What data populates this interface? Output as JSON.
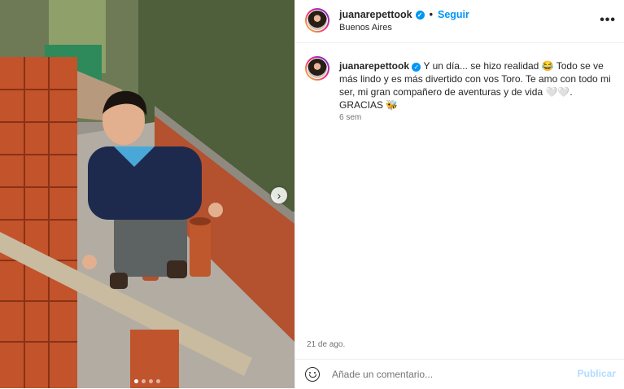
{
  "post": {
    "username": "juanarepettook",
    "follow_label": "Seguir",
    "location": "Buenos Aires",
    "more_label": "•••",
    "verified_mark": "✓",
    "separator": "•"
  },
  "caption": {
    "username": "juanarepettook",
    "text": "Y un día... se hizo realidad 😂 Todo se ve más lindo y es más divertido con vos Toro. Te amo con todo mi ser, mi gran compañero de aventuras y de vida 🤍🤍. GRACIAS 🐝",
    "time_ago": "6 sem"
  },
  "date": "21 de ago.",
  "comment": {
    "placeholder": "Añade un comentario...",
    "publish_label": "Publicar"
  },
  "carousel": {
    "next_label": "›",
    "slides": 4,
    "active_slide": 1
  },
  "colors": {
    "accent": "#0095f6",
    "publish_disabled": "#b3dbff",
    "muted": "#737373"
  }
}
